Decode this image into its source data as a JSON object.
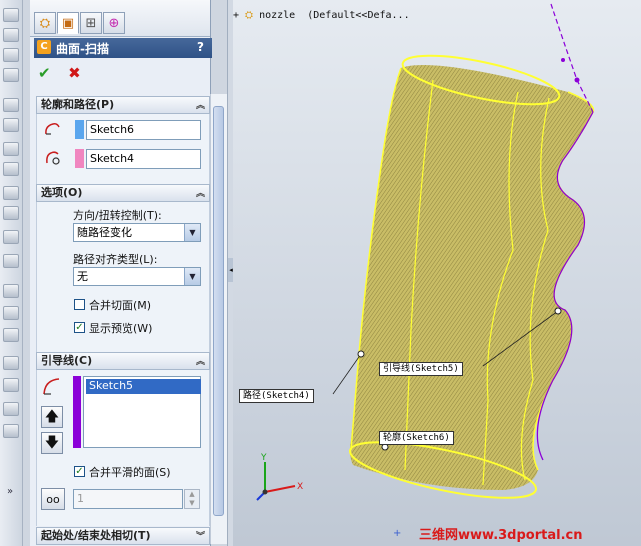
{
  "property_manager": {
    "title": "曲面-扫描",
    "help_symbol": "?",
    "ok_symbol": "✔",
    "cancel_symbol": "✖"
  },
  "tabs": [
    {
      "icon": "feature-manager-icon"
    },
    {
      "icon": "property-manager-icon"
    },
    {
      "icon": "configuration-manager-icon"
    },
    {
      "icon": "dim-xpert-icon"
    }
  ],
  "profile_path": {
    "header": "轮廓和路径(P)",
    "profile_value": "Sketch6",
    "path_value": "Sketch4",
    "profile_color": "#5aa6ee",
    "path_color": "#f086c0"
  },
  "options": {
    "header": "选项(O)",
    "orientation_label": "方向/扭转控制(T):",
    "orientation_value": "随路径变化",
    "alignment_label": "路径对齐类型(L):",
    "alignment_value": "无",
    "merge_tangent_label": "合并切面(M)",
    "merge_tangent_checked": false,
    "show_preview_label": "显示预览(W)",
    "show_preview_checked": true
  },
  "guide_curves": {
    "header": "引导线(C)",
    "items": [
      "Sketch5"
    ],
    "merge_smooth_label": "合并平滑的面(S)",
    "merge_smooth_checked": true,
    "spin_value": "1",
    "bar_color": "#8b00d8"
  },
  "start_end": {
    "header": "起始处/结束处相切(T)"
  },
  "graphics": {
    "tree_text": "nozzle  (Default<<Defa...",
    "callout_path": "路径(Sketch4)",
    "callout_guide": "引导线(Sketch5)",
    "callout_profile": "轮廓(Sketch6)",
    "triad_x": "X",
    "triad_y": "Y",
    "watermark": "三维网www.3dportal.cn",
    "surface_color": "#c7b861",
    "edge_color": "#ffff33"
  }
}
